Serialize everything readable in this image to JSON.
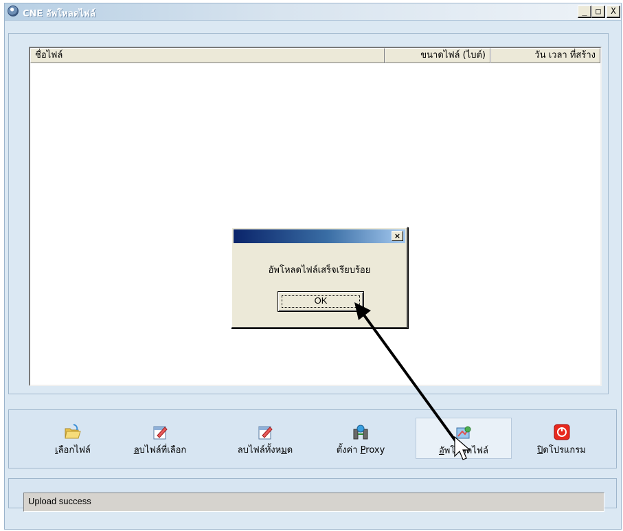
{
  "window": {
    "title": "CNE อัพโหลดไฟล์",
    "controls": [
      "_",
      "□",
      "X"
    ]
  },
  "file_list": {
    "columns": [
      "ชื่อไฟล์",
      "ขนาดไฟล์ (ไบต์)",
      "วัน เวลา ที่สร้าง"
    ],
    "rows": []
  },
  "dialog": {
    "message": "อัพโหลดไฟล์เสร็จเรียบร้อย",
    "ok_label": "OK",
    "close_glyph": "×"
  },
  "toolbar": {
    "select_file": {
      "accel": "เ",
      "rest": "ลือกไฟล์",
      "icon": "folder-icon"
    },
    "delete_selected": {
      "accel": "ล",
      "rest": "บไฟล์ที่เลือก",
      "icon": "delete-selected-icon"
    },
    "delete_all": {
      "pre": "ลบไฟล์ทั้งห",
      "accel": "ม",
      "rest": "ด",
      "icon": "delete-all-icon"
    },
    "proxy": {
      "pre": "ตั้งค่า ",
      "accel": "P",
      "rest": "roxy",
      "icon": "proxy-icon"
    },
    "upload": {
      "accel": "อั",
      "rest": "พโหลดไฟล์",
      "icon": "upload-icon"
    },
    "exit": {
      "accel": "ปิ",
      "rest": "ดโปรแกรม",
      "icon": "power-icon"
    }
  },
  "status": {
    "text": "Upload success"
  },
  "colors": {
    "window_bg": "#dbe8f3",
    "dialog_title": "#0a246a",
    "power_red": "#e8281d",
    "annotation_arrow": "#000000"
  }
}
